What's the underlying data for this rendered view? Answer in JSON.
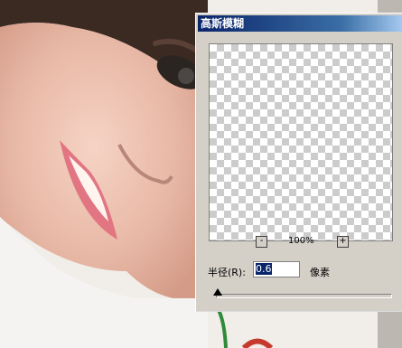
{
  "dialog": {
    "title": "高斯模糊",
    "zoom_out_label": "-",
    "zoom_in_label": "+",
    "zoom_level": "100%",
    "radius_label": "半径(R):",
    "radius_value": "0.6",
    "radius_unit": "像素"
  }
}
